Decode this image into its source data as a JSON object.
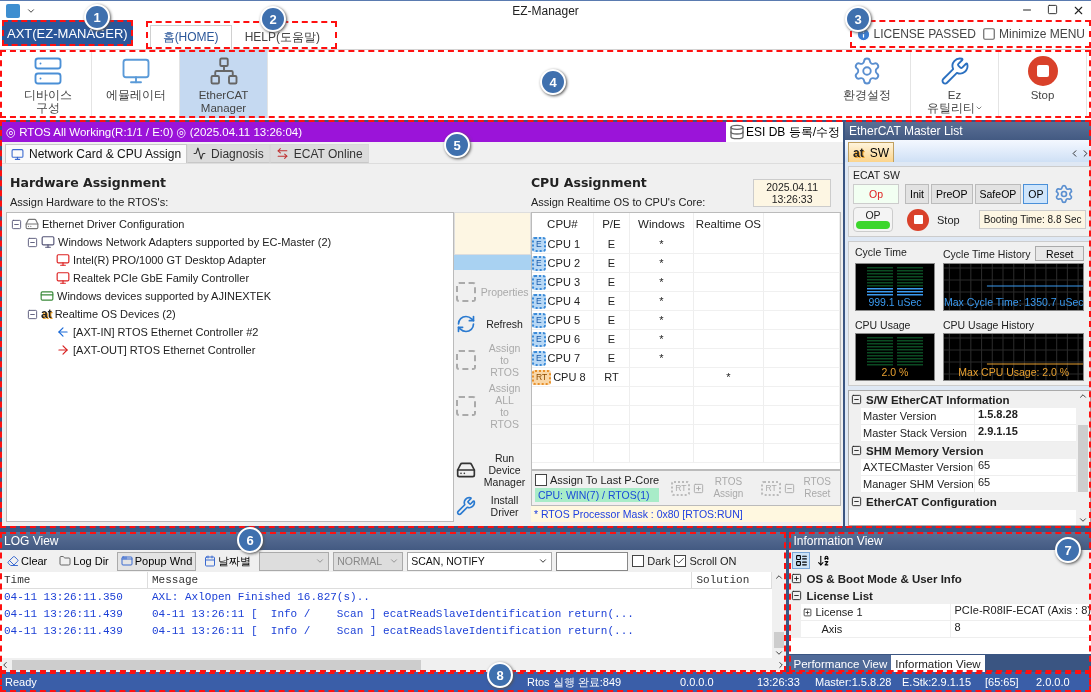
{
  "window": {
    "title": "EZ-Manager",
    "app_button": "AXT(EZ-MANAGER)"
  },
  "ribbon_tabs": [
    {
      "label": "홈(HOME)",
      "selected": true
    },
    {
      "label": "HELP(도움말)",
      "selected": false
    }
  ],
  "ribbon_status": [
    {
      "kind": "info",
      "label": "LICENSE PASSED"
    },
    {
      "kind": "toggle",
      "label": "Minimize MENU"
    }
  ],
  "ribbon_left": [
    {
      "kind": "device",
      "lines": [
        "디바이스",
        "구성"
      ],
      "selected": false
    },
    {
      "kind": "emulator",
      "lines": [
        "에뮬레이터"
      ],
      "selected": false
    },
    {
      "kind": "ethercat",
      "lines": [
        "EtherCAT",
        "Manager"
      ],
      "selected": true
    }
  ],
  "ribbon_right": [
    {
      "kind": "settings",
      "lines": [
        "환경설정"
      ],
      "selected": false,
      "dropdown": false
    },
    {
      "kind": "utility",
      "lines": [
        "Ez",
        "유틸리티"
      ],
      "selected": false,
      "dropdown": true
    },
    {
      "kind": "stop",
      "lines": [
        "Stop"
      ],
      "selected": false,
      "dropdown": false
    }
  ],
  "banner": {
    "text": "◎ RTOS All Working(R:1/1 / E:0) ◎ (2025.04.11 13:26:04)",
    "esi_button": "ESI DB 등록/수정"
  },
  "main_tabs": [
    {
      "kind": "network",
      "label": "Network Card & CPU Assign",
      "selected": true
    },
    {
      "kind": "diagnosis",
      "label": "Diagnosis",
      "selected": false
    },
    {
      "kind": "online",
      "label": "ECAT Online",
      "selected": false
    }
  ],
  "hardware": {
    "title": "Hardware Assignment",
    "subtitle": "Assign Hardware to the RTOS's:",
    "tree": [
      {
        "kind": "root",
        "label": "Ethernet Driver Configuration",
        "expanded": true,
        "children": [
          {
            "kind": "adapters",
            "label": "Windows Network Adapters supported by EC-Master (2)",
            "expanded": true,
            "children": [
              {
                "kind": "nic",
                "label": "Intel(R) PRO/1000 GT Desktop Adapter"
              },
              {
                "kind": "nic",
                "label": "Realtek PCIe GbE Family Controller"
              }
            ]
          },
          {
            "kind": "card",
            "label": "Windows devices supported by AJINEXTEK"
          },
          {
            "kind": "rtos",
            "badge": "at",
            "label": "Realtime OS Devices (2)",
            "expanded": true,
            "children": [
              {
                "kind": "in",
                "label": "[AXT-IN] RTOS Ethernet Controller #2"
              },
              {
                "kind": "out",
                "label": "[AXT-OUT] RTOS Ethernet Controller"
              }
            ]
          }
        ]
      }
    ]
  },
  "actions": [
    {
      "kind": "properties",
      "lines": [
        "Properties"
      ],
      "disabled": true
    },
    {
      "kind": "refresh",
      "lines": [
        "Refresh"
      ],
      "disabled": false
    },
    {
      "kind": "assign",
      "lines": [
        "Assign",
        "to",
        "RTOS"
      ],
      "disabled": true
    },
    {
      "kind": "assign",
      "lines": [
        "Assign ALL",
        "to",
        "RTOS"
      ],
      "disabled": true
    },
    {
      "kind": "device_manager",
      "lines": [
        "Run Device",
        "Manager"
      ],
      "disabled": false
    },
    {
      "kind": "install",
      "lines": [
        "Install Driver"
      ],
      "disabled": false
    }
  ],
  "cpu": {
    "title": "CPU Assignment",
    "subtitle": "Assign Realtime OS to CPU's Core:",
    "date": "2025.04.11",
    "time": "13:26:33",
    "columns": [
      "CPU#",
      "P/E",
      "Windows",
      "Realtime OS"
    ],
    "rows": [
      {
        "kind": "efficiency",
        "chip": "E",
        "cpu": "CPU 1",
        "pe": "E",
        "windows": "*"
      },
      {
        "kind": "efficiency",
        "chip": "E",
        "cpu": "CPU 2",
        "pe": "E",
        "windows": "*"
      },
      {
        "kind": "efficiency",
        "chip": "E",
        "cpu": "CPU 3",
        "pe": "E",
        "windows": "*"
      },
      {
        "kind": "efficiency",
        "chip": "E",
        "cpu": "CPU 4",
        "pe": "E",
        "windows": "*"
      },
      {
        "kind": "efficiency",
        "chip": "E",
        "cpu": "CPU 5",
        "pe": "E",
        "windows": "*"
      },
      {
        "kind": "efficiency",
        "chip": "E",
        "cpu": "CPU 6",
        "pe": "E",
        "windows": "*"
      },
      {
        "kind": "efficiency",
        "chip": "E",
        "cpu": "CPU 7",
        "pe": "E",
        "windows": "*"
      },
      {
        "kind": "realtime",
        "chip": "RT",
        "cpu": "CPU 8",
        "pe": "RT",
        "rtos": "*"
      }
    ],
    "last_pcore": {
      "label": "Assign To Last P-Core",
      "checked": false
    },
    "summary": "CPU: WIN(7) / RTOS(1)",
    "rtos_buttons": [
      {
        "kind": "assign",
        "chip": "RT",
        "lines": [
          "RTOS",
          "Assign"
        ],
        "disabled": true
      },
      {
        "kind": "reset",
        "chip": "RT",
        "lines": [
          "RTOS",
          "Reset"
        ],
        "disabled": true
      }
    ],
    "mask_note": "* RTOS Processor Mask : 0x80 [RTOS:RUN]"
  },
  "master": {
    "title": "EtherCAT Master List",
    "tab": {
      "badge": "at",
      "label": "SW"
    },
    "group": "ECAT SW",
    "state": "Op",
    "state_buttons": [
      {
        "label": "Init",
        "selected": false
      },
      {
        "label": "PreOP",
        "selected": false
      },
      {
        "label": "SafeOP",
        "selected": false
      },
      {
        "label": "OP",
        "selected": true
      }
    ],
    "op_indicator": {
      "label": "OP",
      "on": true
    },
    "stop": "Stop",
    "booting": "Booting Time: 8.8 Sec",
    "cycle_time": {
      "title": "Cycle Time",
      "reading": "999.1 uSec"
    },
    "cycle_history": {
      "title": "Cycle Time History",
      "reset": "Reset",
      "reading": "Max Cycle Time: 1350.7 uSec"
    },
    "cpu_usage": {
      "title": "CPU Usage",
      "reading": "2.0 %"
    },
    "cpu_history": {
      "title": "CPU Usage History",
      "reading": "Max CPU Usage: 2.0 %"
    },
    "properties": [
      {
        "kind": "category",
        "label": "S/W EtherCAT Information",
        "expanded": true
      },
      {
        "kind": "property",
        "name": "Master Version",
        "value": "1.5.8.28",
        "bold": true
      },
      {
        "kind": "property",
        "name": "Master Stack Version",
        "value": "2.9.1.15",
        "bold": true
      },
      {
        "kind": "category",
        "label": "SHM Memory Version",
        "expanded": true
      },
      {
        "kind": "property",
        "name": "AXTECMaster Version",
        "value": "65",
        "bold": false
      },
      {
        "kind": "property",
        "name": "Manager SHM Version",
        "value": "65",
        "bold": false
      },
      {
        "kind": "category",
        "label": "EtherCAT Configuration",
        "expanded": true
      }
    ]
  },
  "log": {
    "title": "LOG View",
    "toolbar": [
      {
        "kind": "clear",
        "label": "Clear",
        "selected": false
      },
      {
        "kind": "folder",
        "label": "Log Dir",
        "selected": false
      },
      {
        "kind": "popup",
        "label": "Popup Wnd",
        "selected": true
      },
      {
        "kind": "calendar",
        "label": "날짜별",
        "selected": false
      }
    ],
    "filters": [
      {
        "kind": "blank",
        "disabled": true
      },
      {
        "kind": "level",
        "value": "NORMAL",
        "disabled": true
      },
      {
        "kind": "category",
        "value": "SCAN, NOTIFY",
        "disabled": false
      }
    ],
    "checkboxes": [
      {
        "label": "Dark",
        "checked": false
      },
      {
        "label": "Scroll ON",
        "checked": true
      }
    ],
    "columns": [
      "Time",
      "Message",
      "Solution"
    ],
    "rows": [
      {
        "time": "04-11 13:26:11.350",
        "message": "AXL: AxlOpen Finished 16.827(s).."
      },
      {
        "time": "04-11 13:26:11.439",
        "message": "04-11 13:26:11 [  Info /    Scan ] ecatReadSlaveIdentification return(..."
      },
      {
        "time": "04-11 13:26:11.439",
        "message": "04-11 13:26:11 [  Info /    Scan ] ecatReadSlaveIdentification return(..."
      }
    ]
  },
  "info": {
    "title": "Information View",
    "rows": [
      {
        "kind": "category",
        "label": "OS & Boot Mode & User Info",
        "expanded": false
      },
      {
        "kind": "category",
        "label": "License List",
        "expanded": true
      },
      {
        "kind": "property",
        "name": "License 1",
        "value": "PCIe-R08IF-ECAT (Axis : 8)"
      },
      {
        "kind": "subproperty",
        "name": "Axis",
        "value": "8"
      }
    ],
    "tabs": [
      {
        "label": "Performance View",
        "selected": false
      },
      {
        "label": "Information View",
        "selected": true
      }
    ]
  },
  "status_bar": [
    "Ready",
    "Rtos 실행 완료:849",
    "0.0.0.0",
    "13:26:33",
    "Master:1.5.8.28",
    "E.Stk:2.9.1.15",
    "[65:65]",
    "2.0.0.0"
  ],
  "callouts": [
    "1",
    "2",
    "3",
    "4",
    "5",
    "6",
    "7",
    "8"
  ]
}
